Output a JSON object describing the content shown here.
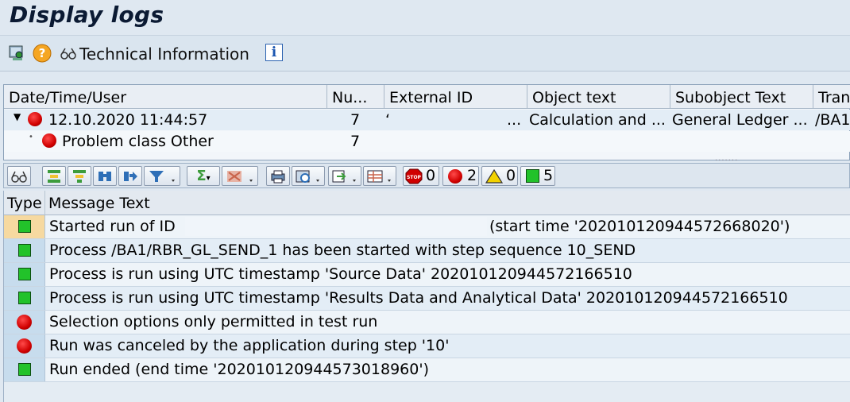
{
  "title": "Display logs",
  "toolbar": {
    "tech_info_label": "Technical Information",
    "info_button": "i"
  },
  "upper_table": {
    "columns": [
      "Date/Time/User",
      "Nu...",
      "External ID",
      "Object text",
      "Subobject Text",
      "Tran"
    ],
    "rows": [
      {
        "date_time": "12.10.2020  11:44:57",
        "number": "7",
        "external_id": "‘",
        "ellipsis": "...",
        "object_text": "Calculation and ...",
        "subobject_text": "General Ledger ...",
        "tran": "/BA1"
      },
      {
        "label": "Problem class Other",
        "number": "7"
      }
    ]
  },
  "alv_toolbar": {
    "stop_count": "0",
    "error_count": "2",
    "warning_count": "0",
    "success_count": "5"
  },
  "messages": {
    "columns": [
      "Type",
      "Message Text"
    ],
    "rows": [
      {
        "type": "success",
        "text": "Started run of ID",
        "extra": "(start time '20201012094457266802​0')"
      },
      {
        "type": "success",
        "text": "Process /BA1/RBR_GL_SEND_1 has been started with step sequence 10_SEND"
      },
      {
        "type": "success",
        "text": "Process is run using UTC timestamp 'Source Data' 20201012094457216651​0"
      },
      {
        "type": "success",
        "text": "Process is run using UTC timestamp 'Results Data and Analytical Data' 20201012094457216651​0"
      },
      {
        "type": "error",
        "text": "Selection options only permitted in test run"
      },
      {
        "type": "error",
        "text": "Run was canceled by the application during step '10'"
      },
      {
        "type": "success",
        "text": "Run ended (end time '20201012094457301896​0')"
      }
    ]
  },
  "colors": {
    "success": "#22c22a",
    "error": "#d00000",
    "warning": "#f2d200",
    "selected_row": "#f6d9a0"
  }
}
